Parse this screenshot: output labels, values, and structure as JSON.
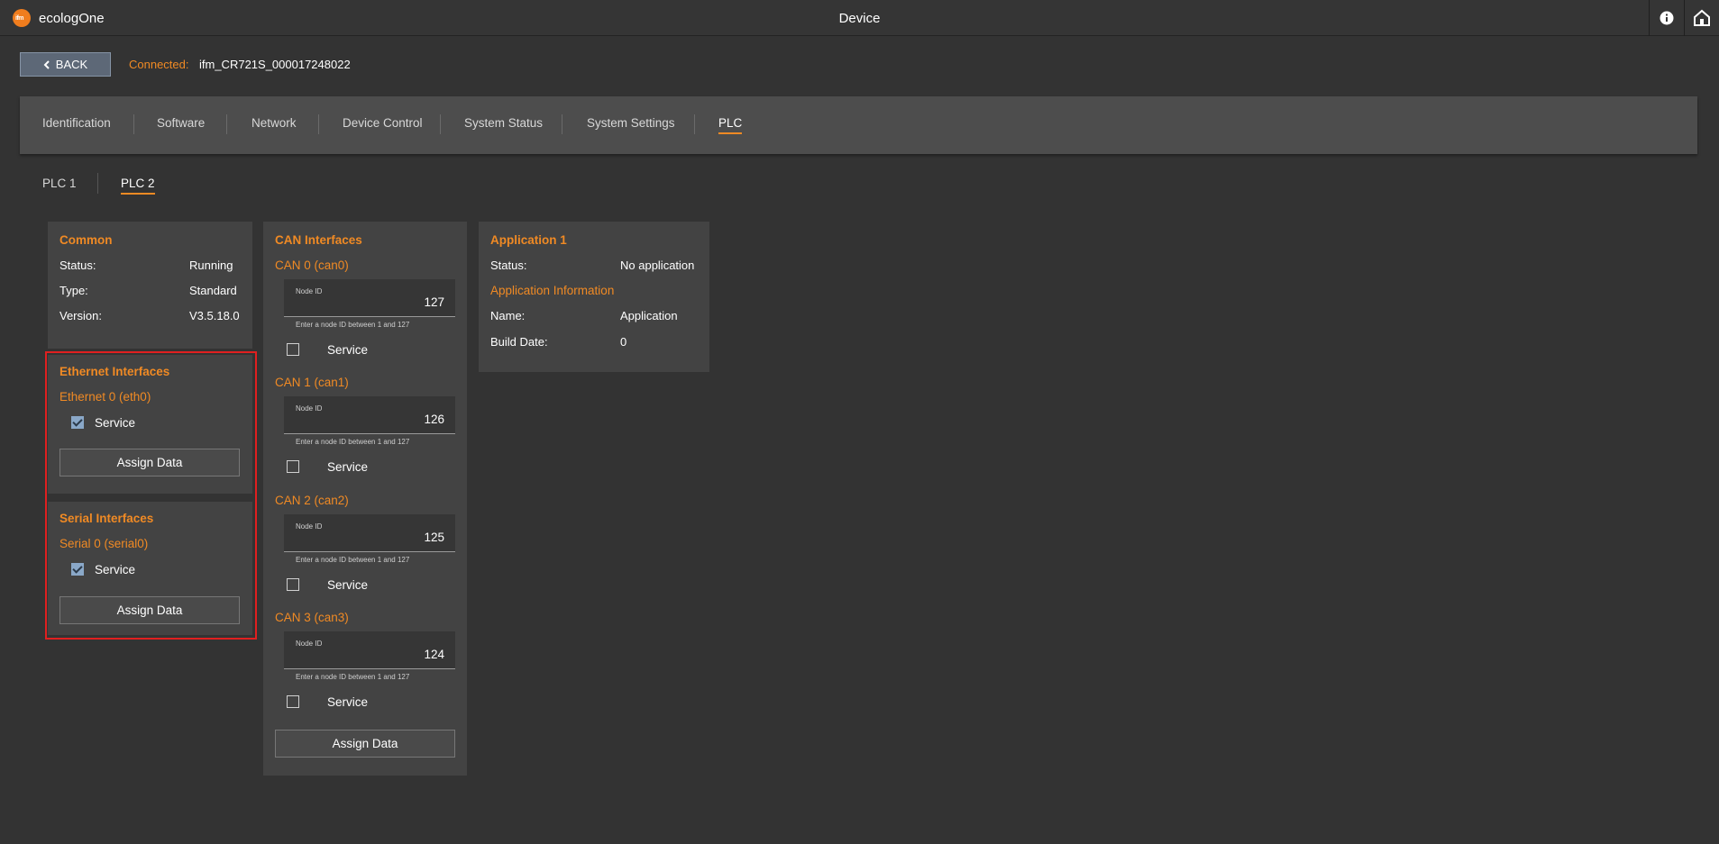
{
  "app": {
    "name": "ecologOne",
    "logo_text": "ifm",
    "window_title": "Device"
  },
  "titlebar_icons": {
    "info": "info-icon",
    "home": "home-icon"
  },
  "header": {
    "back_label": "BACK",
    "connected_label": "Connected:",
    "connected_value": "ifm_CR721S_000017248022"
  },
  "tabs": [
    {
      "label": "Identification",
      "active": false
    },
    {
      "label": "Software",
      "active": false
    },
    {
      "label": "Network",
      "active": false
    },
    {
      "label": "Device Control",
      "active": false
    },
    {
      "label": "System Status",
      "active": false
    },
    {
      "label": "System Settings",
      "active": false
    },
    {
      "label": "PLC",
      "active": true
    }
  ],
  "subtabs": [
    {
      "label": "PLC 1",
      "active": false
    },
    {
      "label": "PLC 2",
      "active": true
    }
  ],
  "common": {
    "title": "Common",
    "rows": [
      {
        "key": "Status:",
        "value": "Running"
      },
      {
        "key": "Type:",
        "value": "Standard"
      },
      {
        "key": "Version:",
        "value": "V3.5.18.0"
      }
    ]
  },
  "ethernet": {
    "title": "Ethernet Interfaces",
    "interface": "Ethernet 0 (eth0)",
    "service_label": "Service",
    "service_checked": true,
    "assign_label": "Assign Data"
  },
  "serial": {
    "title": "Serial Interfaces",
    "interface": "Serial 0 (serial0)",
    "service_label": "Service",
    "service_checked": true,
    "assign_label": "Assign Data"
  },
  "can": {
    "title": "CAN Interfaces",
    "interfaces": [
      {
        "name": "CAN 0 (can0)",
        "field_label": "Node ID",
        "node_id": "127",
        "help": "Enter a node ID between 1 and 127",
        "service_label": "Service",
        "service_checked": false
      },
      {
        "name": "CAN 1 (can1)",
        "field_label": "Node ID",
        "node_id": "126",
        "help": "Enter a node ID between 1 and 127",
        "service_label": "Service",
        "service_checked": false
      },
      {
        "name": "CAN 2 (can2)",
        "field_label": "Node ID",
        "node_id": "125",
        "help": "Enter a node ID between 1 and 127",
        "service_label": "Service",
        "service_checked": false
      },
      {
        "name": "CAN 3 (can3)",
        "field_label": "Node ID",
        "node_id": "124",
        "help": "Enter a node ID between 1 and 127",
        "service_label": "Service",
        "service_checked": false
      }
    ],
    "assign_label": "Assign Data"
  },
  "application": {
    "title": "Application 1",
    "status_key": "Status:",
    "status_value": "No application",
    "info_title": "Application Information",
    "name_key": "Name:",
    "name_value": "Application",
    "build_key": "Build Date:",
    "build_value": "0"
  },
  "colors": {
    "accent": "#f08a24",
    "background": "#333333",
    "card": "#434343",
    "highlight": "#e02020"
  }
}
